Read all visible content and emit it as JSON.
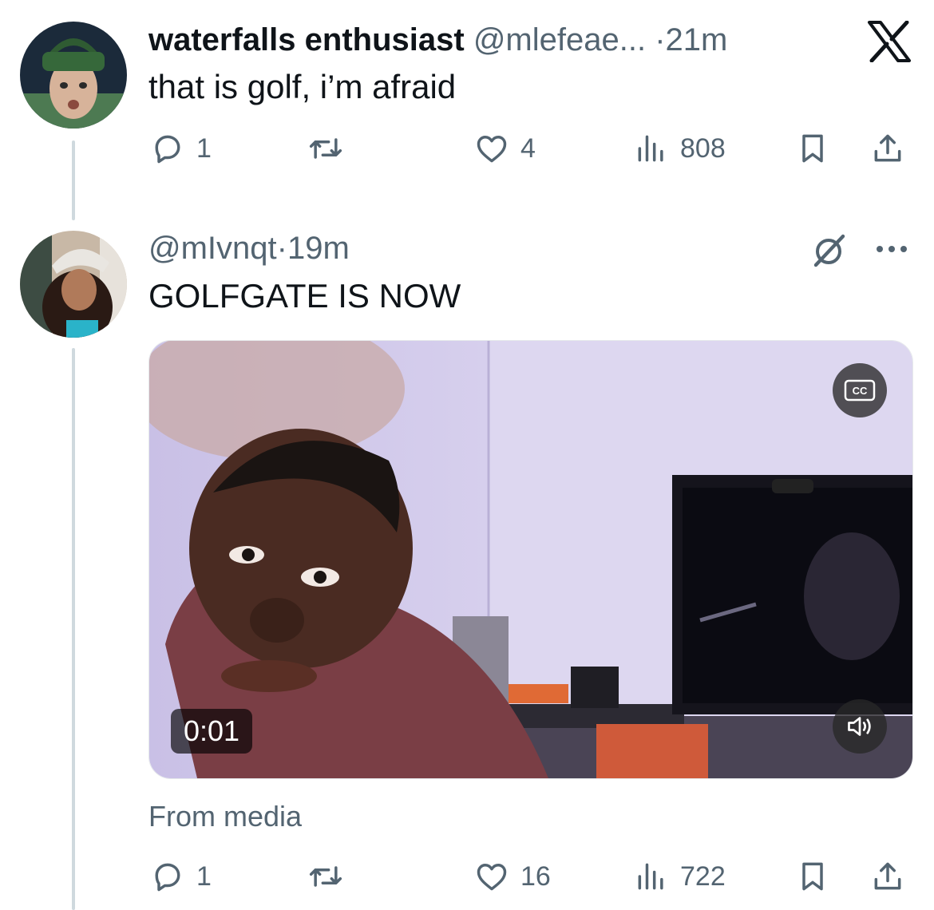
{
  "tweets": [
    {
      "display_name": "waterfalls enthusiast",
      "handle": "@mlefeae...",
      "time": "·21m",
      "text": "that is golf, i’m afraid",
      "replies": "1",
      "likes": "4",
      "views": "808"
    },
    {
      "handle": "@mIvnqt",
      "time": "·19m",
      "text": "GOLFGATE IS NOW",
      "video": {
        "timer": "0:01",
        "cc_label": "CC"
      },
      "source_label": "From media",
      "replies": "1",
      "likes": "16",
      "views": "722"
    }
  ],
  "icons": {
    "logo": "x-logo-icon",
    "reply": "reply-icon",
    "retweet": "retweet-icon",
    "like": "heart-icon",
    "views": "views-icon",
    "bookmark": "bookmark-icon",
    "share": "share-icon",
    "grok": "grok-icon",
    "more": "more-icon",
    "volume": "volume-icon"
  },
  "colors": {
    "text": "#0f1419",
    "secondary": "#536471",
    "thread_line": "#cfd9de"
  }
}
